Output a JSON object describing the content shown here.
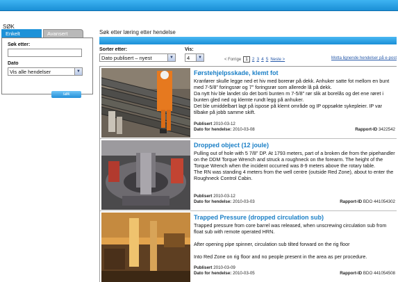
{
  "colors": {
    "accent": "#1e92d8",
    "title_blue": "#1a7fc6",
    "link_blue": "#2457a8"
  },
  "sidebar": {
    "heading": "SØK",
    "tabs": [
      {
        "label": "Enkelt",
        "active": true
      },
      {
        "label": "Avansert",
        "active": false
      }
    ],
    "search_label": "Søk etter:",
    "search_value": "",
    "date_label": "Dato",
    "date_selected": "Vis alle hendelser",
    "search_button": "søk"
  },
  "main": {
    "title": "Søk etter læring etter hendelse",
    "sort_label": "Sorter etter:",
    "sort_selected": "Dato publisert – nyest",
    "show_label": "Vis:",
    "show_selected": "4",
    "pager": {
      "prev": "< Forrige",
      "pages": [
        "1",
        "2",
        "3",
        "4",
        "5"
      ],
      "current": "1",
      "next": "Neste >"
    },
    "email_link": "Motta lignende hendelser på e-post"
  },
  "incidents": [
    {
      "title": "Førstehjelpsskade, klemt fot",
      "body": [
        "Kranfører skulle legge ned et hiv med borerør på dekk. Anhuker satte fot mellom en bunt med 7-5/8\" foringsrør og 7\" foringsrør som allerede lå på dekk.",
        "Da nytt hiv ble landet slo det borti bunten m 7-5/8\" rør slik at borelås og det ene røret i bunten gled ned og klemte rundt legg på anhuker.",
        "Det ble umiddelbart lagt på ispose på klemt område og IP oppsøkte sykepleier. IP var tilbake på jobb samme skift."
      ],
      "published_label": "Publisert",
      "published": "2010-03-12",
      "event_date_label": "Dato for hendelse:",
      "event_date": "2010-03-08",
      "report_label": "Rapport-ID",
      "report_id": "3422542"
    },
    {
      "title": "Dropped object (12 joule)",
      "body": [
        "Pulling out of hole with 5 7/8\" DP. At 1793 meters, part of a broken die from the pipehandler on the DDM Torque Wrench and struck a roughneck on the forearm. The height of the Torque Wrench when the incident occurred was 8-9 meters above the rotary table.",
        "The RN was standing 4 meters from the well centre (outside Red Zone), about to enter the Roughneck Control Cabin."
      ],
      "published_label": "Publisert",
      "published": "2010-03-12",
      "event_date_label": "Dato for hendelse:",
      "event_date": "2010-03-03",
      "report_label": "Rapport-ID",
      "report_id": "BDO 441054302"
    },
    {
      "title": "Trapped Pressure (dropped circulation sub)",
      "body": [
        "Trapped pressure from core barrel was released, when unscrewing circulation sub from float sub with remote operated HRN.",
        "",
        "After opening pipe spinner, circulation sub tilted forward on the rig floor",
        "",
        "Into Red Zone on rig floor and no people present in the area as per procedure."
      ],
      "published_label": "Publisert",
      "published": "2010-03-09",
      "event_date_label": "Dato for hendelse:",
      "event_date": "2010-03-05",
      "report_label": "Rapport-ID",
      "report_id": "BDO 441054508"
    }
  ]
}
